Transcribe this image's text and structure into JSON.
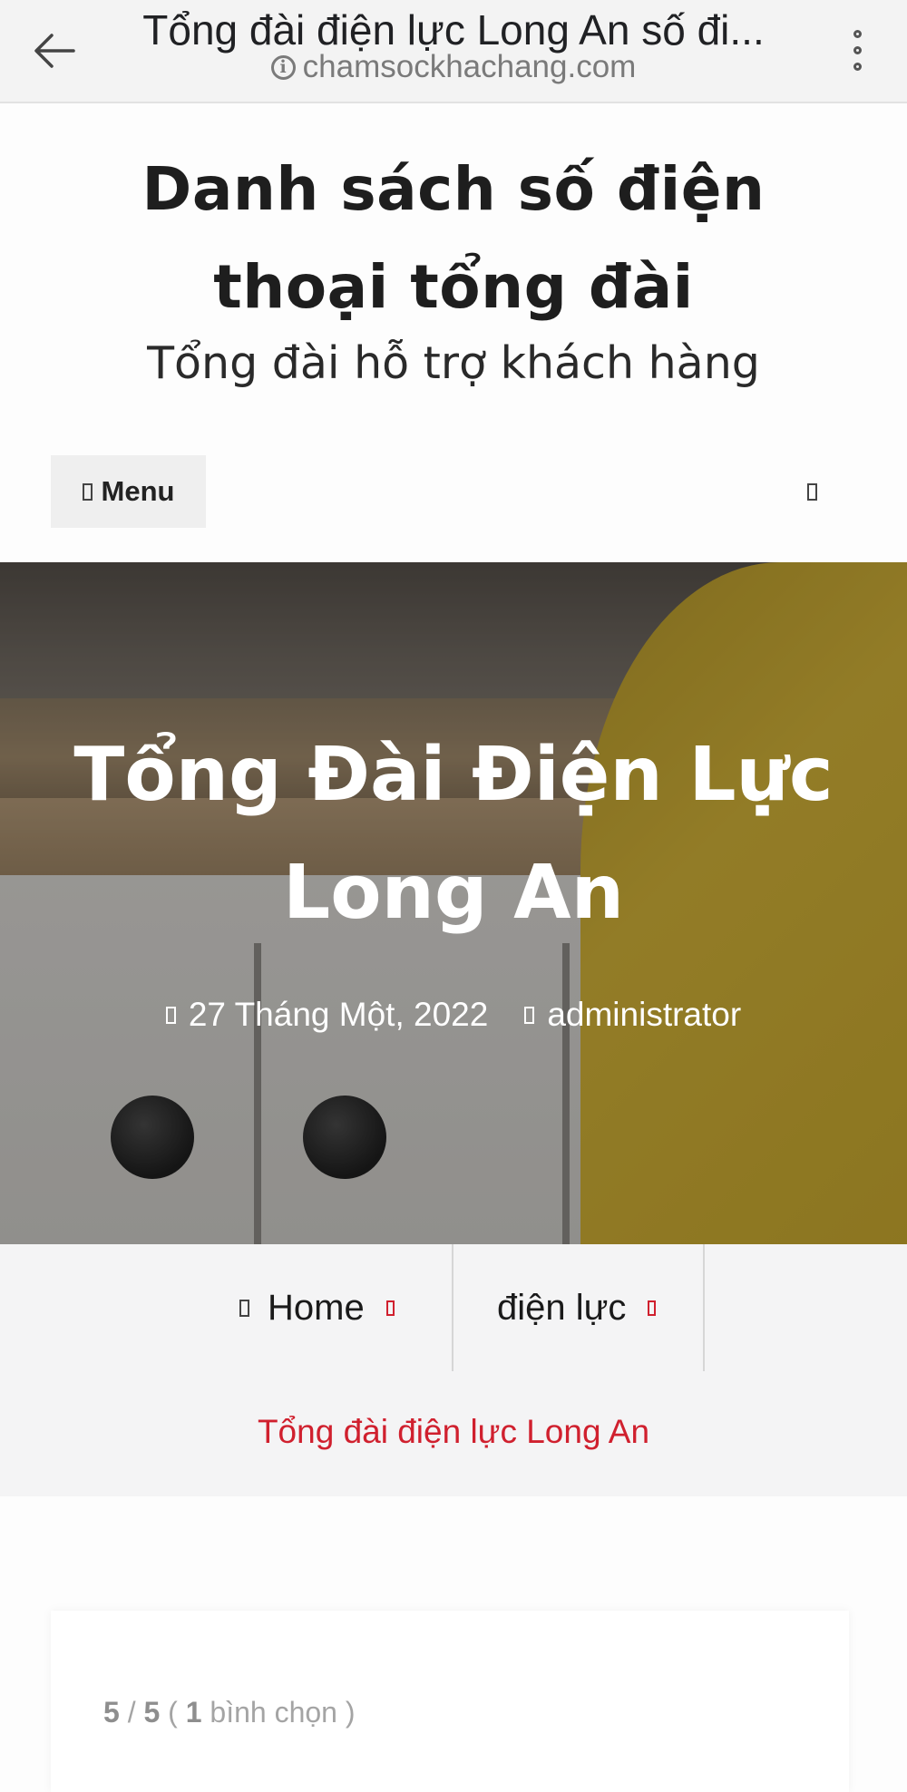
{
  "browser": {
    "page_title": "Tổng đài điện lực Long An số đi...",
    "url": "chamsockhachang.com",
    "icons": {
      "back": "arrow-left-icon",
      "info": "info-icon",
      "more": "kebab-menu-icon"
    }
  },
  "site": {
    "title": "Danh sách số điện thoại tổng đài",
    "tagline": "Tổng đài hỗ trợ khách hàng"
  },
  "nav": {
    "menu_label": "Menu",
    "icons": {
      "menu": "hamburger-icon",
      "search": "search-icon"
    }
  },
  "hero": {
    "title": "Tổng Đài Điện Lực Long An",
    "date": "27 Tháng Một, 2022",
    "author": "administrator",
    "icons": {
      "date": "calendar-icon",
      "author": "user-icon"
    }
  },
  "breadcrumb": {
    "items": [
      {
        "label": "Home"
      },
      {
        "label": "điện lực"
      }
    ],
    "current": "Tổng đài điện lực Long An",
    "accent_color": "#d0202e"
  },
  "rating": {
    "score": "5",
    "max": "5",
    "votes": "1",
    "votes_label": "bình chọn"
  }
}
